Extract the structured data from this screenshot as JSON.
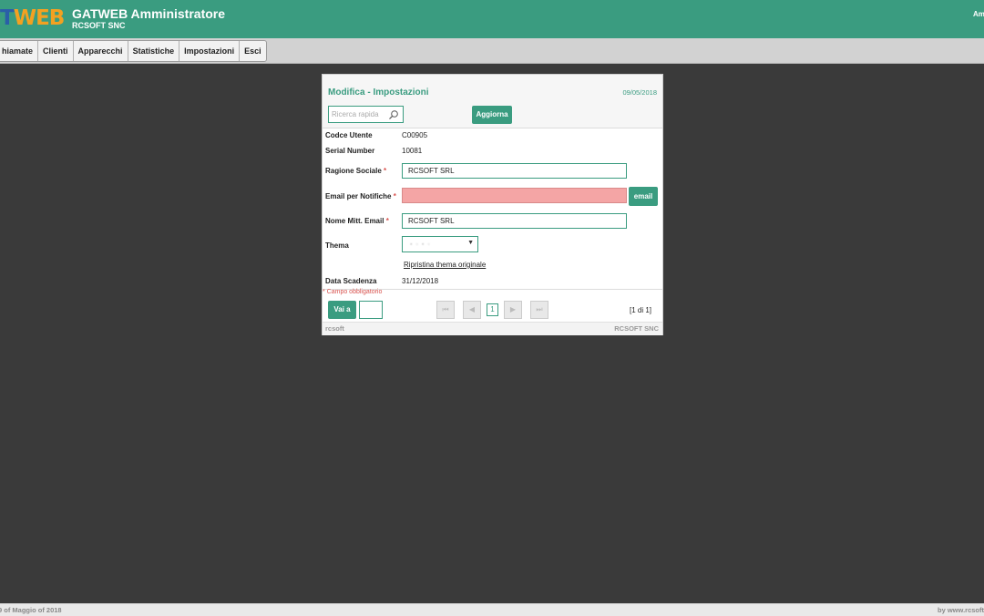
{
  "header": {
    "logo_part1": "T",
    "logo_part2": "WEB",
    "title": "GATWEB Amministratore",
    "subtitle": "RCSOFT SNC",
    "user": "Am"
  },
  "nav": {
    "items": [
      "hiamate",
      "Clienti",
      "Apparecchi",
      "Statistiche",
      "Impostazioni",
      "Esci"
    ]
  },
  "panel": {
    "title": "Modifica - Impostazioni",
    "date": "09/05/2018",
    "search_placeholder": "Ricerca rapida",
    "update_button": "Aggiorna",
    "fields": {
      "codice_utente": {
        "label": "Codce Utente",
        "value": "C00905"
      },
      "serial_number": {
        "label": "Serial Number",
        "value": "10081"
      },
      "ragione_sociale": {
        "label": "Ragione Sociale",
        "value": "RCSOFT SRL"
      },
      "email_notifiche": {
        "label": "Email per Notifiche",
        "value": ""
      },
      "nome_mitt_email": {
        "label": "Nome Mitt. Email",
        "value": "RCSOFT SRL"
      },
      "thema": {
        "label": "Thema"
      },
      "data_scadenza": {
        "label": "Data Scadenza",
        "value": "31/12/2018"
      }
    },
    "required_marker": "*",
    "email_button": "email",
    "reset_theme_link": "Ripristina thema originale",
    "required_note": "* Campo obbligatorio",
    "goto_button": "Vai a",
    "pager": {
      "current_page": "1",
      "info": "[1 di 1]"
    },
    "footer_left": "rcsoft",
    "footer_right": "RCSOFT SNC"
  },
  "page_footer": {
    "left": "9 of Maggio of 2018",
    "right": "by www.rcsoft"
  },
  "colors": {
    "accent": "#3a9c80",
    "error": "#f4a5a5",
    "background": "#3a3a3a"
  }
}
